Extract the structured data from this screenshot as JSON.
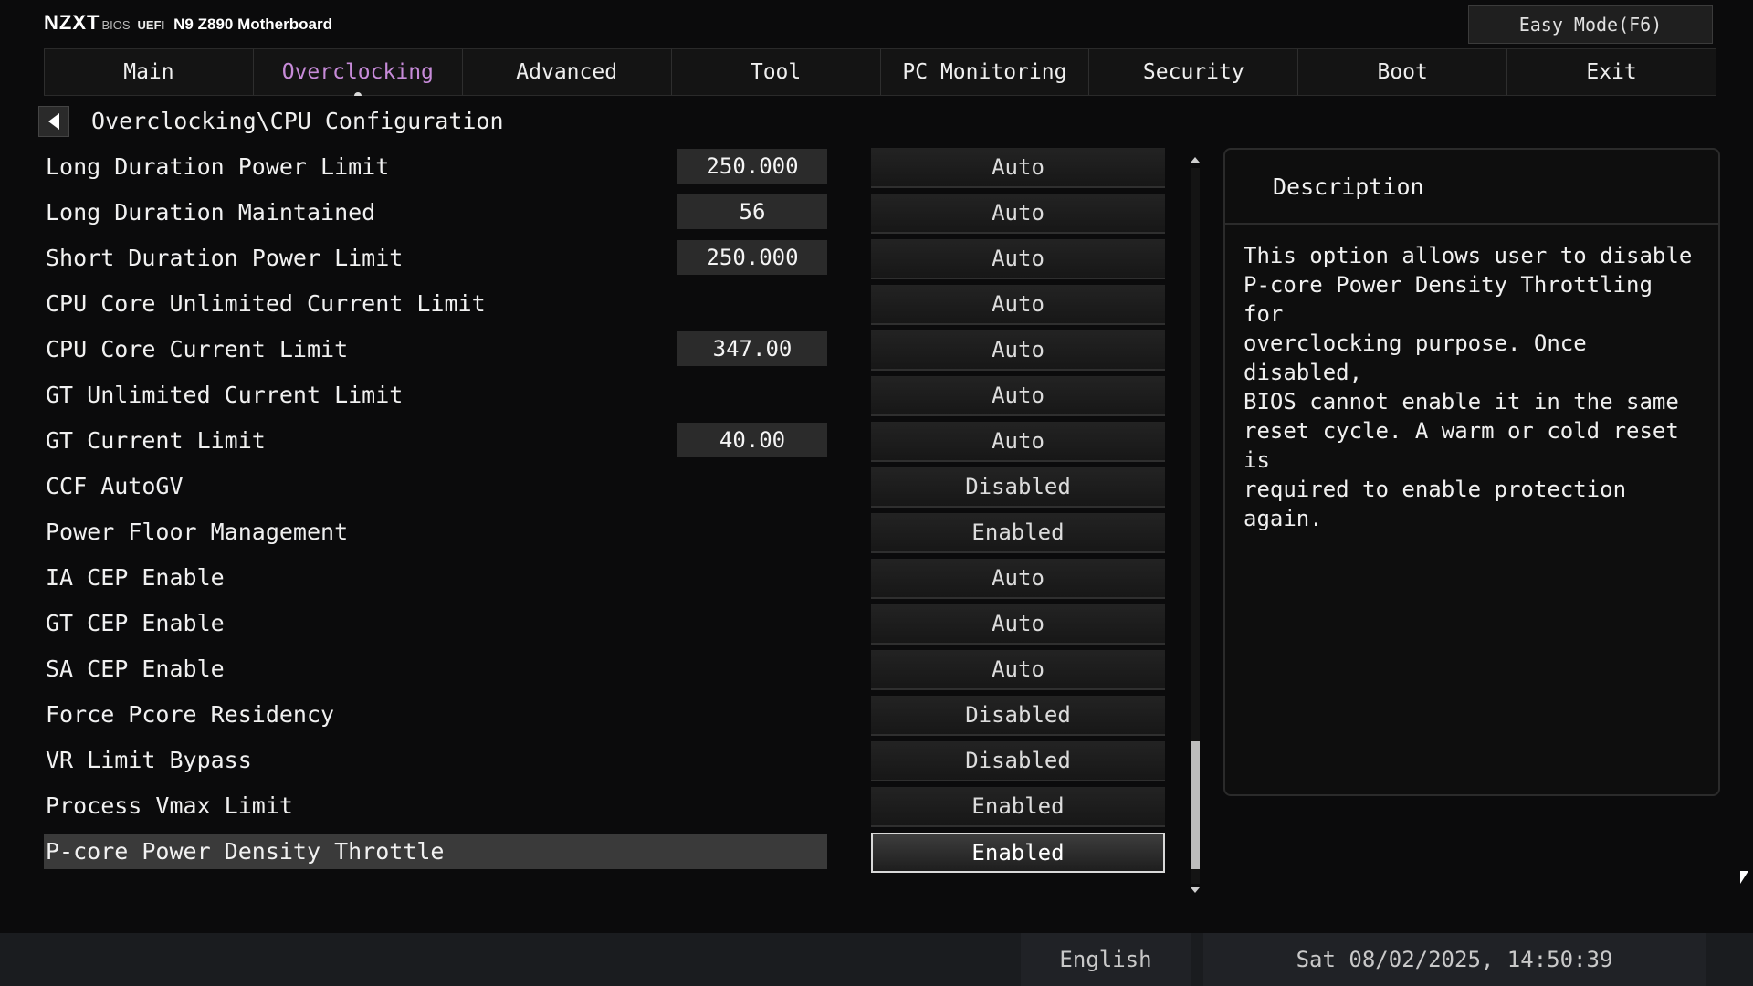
{
  "header": {
    "brand_logo": "NZXT",
    "brand_bios": "BIOS",
    "brand_uefi": "UEFI",
    "model": "N9 Z890 Motherboard",
    "easy_mode": "Easy Mode(F6)"
  },
  "tabs": [
    {
      "label": "Main"
    },
    {
      "label": "Overclocking",
      "active": true
    },
    {
      "label": "Advanced"
    },
    {
      "label": "Tool"
    },
    {
      "label": "PC Monitoring"
    },
    {
      "label": "Security"
    },
    {
      "label": "Boot"
    },
    {
      "label": "Exit"
    }
  ],
  "breadcrumb": "Overclocking\\CPU Configuration",
  "settings": [
    {
      "label": "Long Duration Power Limit",
      "value": "250.000",
      "option": "Auto"
    },
    {
      "label": "Long Duration Maintained",
      "value": "56",
      "option": "Auto"
    },
    {
      "label": "Short Duration Power Limit",
      "value": "250.000",
      "option": "Auto"
    },
    {
      "label": "CPU Core Unlimited Current Limit",
      "value": "",
      "option": "Auto"
    },
    {
      "label": "CPU Core Current Limit",
      "value": "347.00",
      "option": "Auto"
    },
    {
      "label": "GT Unlimited Current Limit",
      "value": "",
      "option": "Auto"
    },
    {
      "label": "GT Current Limit",
      "value": "40.00",
      "option": "Auto"
    },
    {
      "label": "CCF AutoGV",
      "value": "",
      "option": "Disabled"
    },
    {
      "label": "Power Floor Management",
      "value": "",
      "option": "Enabled"
    },
    {
      "label": "IA CEP Enable",
      "value": "",
      "option": "Auto"
    },
    {
      "label": "GT CEP Enable",
      "value": "",
      "option": "Auto"
    },
    {
      "label": "SA CEP Enable",
      "value": "",
      "option": "Auto"
    },
    {
      "label": "Force Pcore Residency",
      "value": "",
      "option": "Disabled"
    },
    {
      "label": "VR Limit Bypass",
      "value": "",
      "option": "Disabled"
    },
    {
      "label": "Process Vmax Limit",
      "value": "",
      "option": "Enabled"
    },
    {
      "label": "P-core Power Density Throttle",
      "value": "",
      "option": "Enabled",
      "selected": true
    }
  ],
  "description": {
    "title": "Description",
    "text": "This option allows user to disable\nP-core Power Density Throttling for\noverclocking purpose. Once disabled,\nBIOS cannot enable it in the same\nreset cycle. A warm or cold reset is\nrequired to enable protection again."
  },
  "footer": {
    "language": "English",
    "datetime": "Sat 08/02/2025, 14:50:39"
  },
  "colors": {
    "active_tab": "#c78bd9",
    "background": "#0b0b0c"
  }
}
